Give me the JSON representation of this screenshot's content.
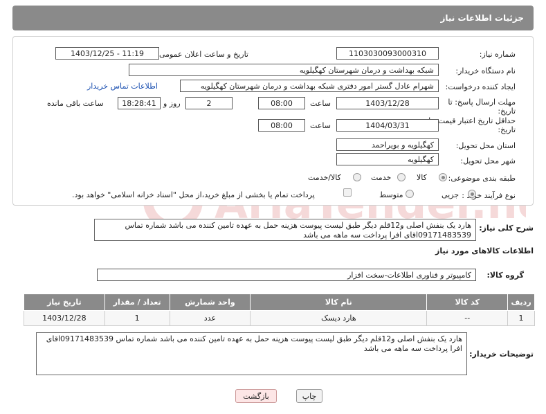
{
  "header": {
    "title": "جزئیات اطلاعات نیاز"
  },
  "form": {
    "need_number_label": "شماره نیاز:",
    "need_number": "1103030093000310",
    "announce_label": "تاریخ و ساعت اعلان عمومی:",
    "announce_value": "1403/12/25 - 11:19",
    "buyer_org_label": "نام دستگاه خریدار:",
    "buyer_org": "شبکه بهداشت و درمان شهرستان کهگیلویه",
    "creator_label": "ایجاد کننده درخواست:",
    "creator": "شهرام عادل گستر امور دفتری شبکه بهداشت و درمان شهرستان کهگیلویه",
    "buyer_contact_link": "اطلاعات تماس خریدار",
    "reply_deadline_label_1": "مهلت ارسال پاسخ: تا",
    "reply_deadline_label_2": "تاریخ:",
    "reply_date": "1403/12/28",
    "time_label": "ساعت",
    "reply_time": "08:00",
    "days_value": "2",
    "days_label": "روز و",
    "remaining_time": "18:28:41",
    "remaining_label": "ساعت باقی مانده",
    "price_validity_label_1": "حداقل تاریخ اعتبار قیمت: تا",
    "price_validity_label_2": "تاریخ:",
    "price_date": "1404/03/31",
    "price_time": "08:00",
    "province_label": "استان محل تحویل:",
    "province": "کهگیلویه و بویراحمد",
    "city_label": "شهر محل تحویل:",
    "city": "کهگیلویه",
    "category_label": "طبقه بندی موضوعی:",
    "category_options": [
      "کالا",
      "خدمت",
      "کالا/خدمت"
    ],
    "process_label": "نوع فرآیند خرید :",
    "process_options": [
      "جزیی",
      "متوسط"
    ],
    "payment_note": "پرداخت تمام یا بخشی از مبلغ خرید،از محل \"اسناد خزانه اسلامی\" خواهد بود."
  },
  "description": {
    "label": "شرح کلی نیاز:",
    "text": "هارد یک بنفش اصلی و12قلم دیگر طبق لیست پیوست هزینه حمل به عهده تامین کننده می باشد شماره تماس 09171483539اقای افرا پرداخت سه ماهه می باشد"
  },
  "goods": {
    "section_title": "اطلاعات کالاهای مورد نیاز",
    "group_label": "گروه کالا:",
    "group_value": "کامپیوتر و فناوری اطلاعات-سخت افزار",
    "columns": [
      "ردیف",
      "کد کالا",
      "نام کالا",
      "واحد شمارش",
      "تعداد / مقدار",
      "تاریخ نیاز"
    ],
    "rows": [
      [
        "1",
        "--",
        "هارد دیسک",
        "عدد",
        "1",
        "1403/12/28"
      ]
    ]
  },
  "buyer_notes": {
    "label": "توضیحات خریدار:",
    "text": "هارد یک بنفش اصلی و12قلم دیگر طبق لیست پیوست هزینه حمل به عهده تامین کننده می باشد شماره تماس 09171483539اقای افرا پرداخت سه ماهه می باشد"
  },
  "buttons": {
    "print": "چاپ",
    "back": "بازگشت"
  },
  "colors": {
    "header_bg": "#8a8a8a",
    "link": "#1a4fb0"
  }
}
